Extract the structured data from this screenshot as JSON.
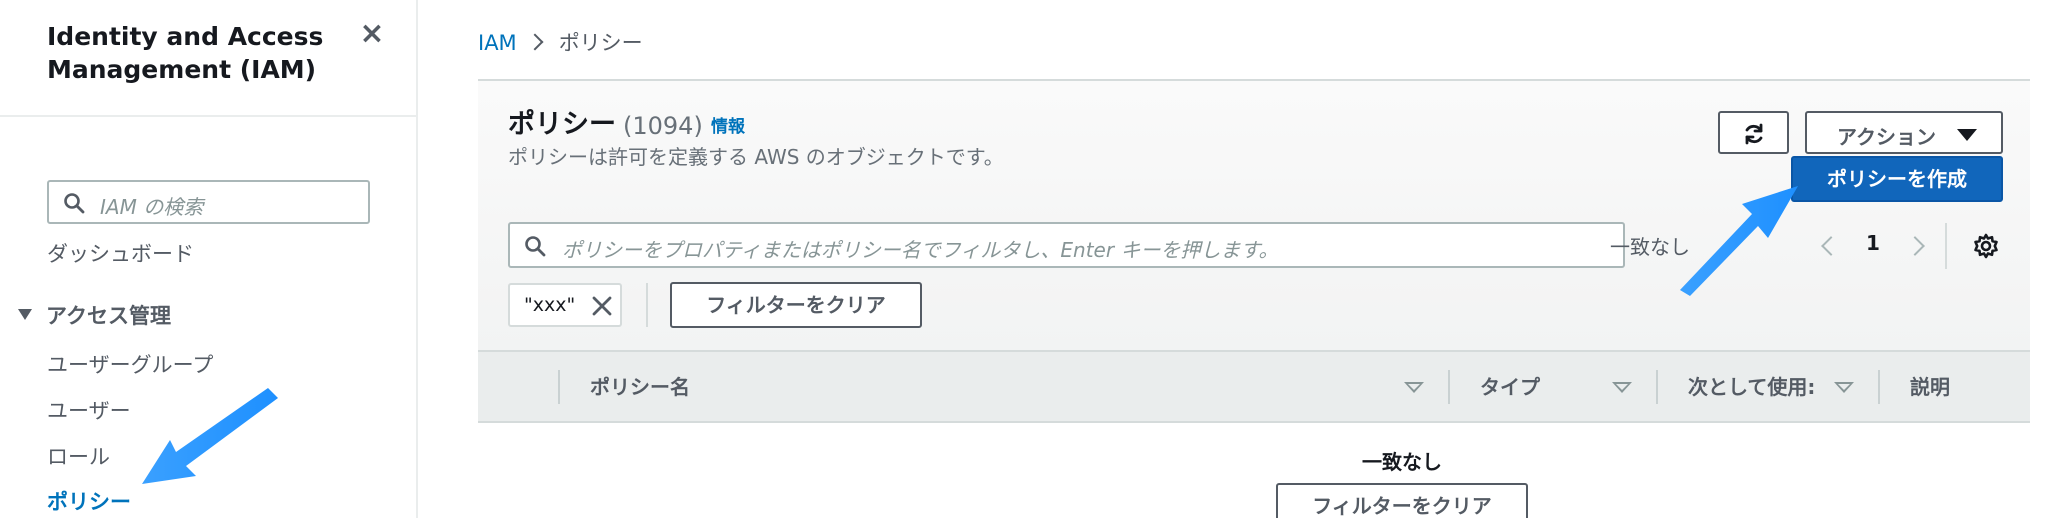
{
  "sidebar": {
    "title": "Identity and Access Management (IAM)",
    "close_icon": "close-icon",
    "search_placeholder": "IAM の検索",
    "dashboard_label": "ダッシュボード",
    "section_label": "アクセス管理",
    "items": [
      {
        "label": "ユーザーグループ"
      },
      {
        "label": "ユーザー"
      },
      {
        "label": "ロール"
      },
      {
        "label": "ポリシー",
        "active": true
      }
    ]
  },
  "breadcrumb": {
    "root": "IAM",
    "current": "ポリシー"
  },
  "panel": {
    "title": "ポリシー",
    "count": "(1094)",
    "info_label": "情報",
    "description": "ポリシーは許可を定義する AWS のオブジェクトです。",
    "actions_label": "アクション",
    "create_label": "ポリシーを作成",
    "filter_placeholder": "ポリシーをプロパティまたはポリシー名でフィルタし、Enter キーを押します。",
    "match_text": "一致なし",
    "page_number": "1",
    "token_label": "\"xxx\"",
    "clear_filter_label": "フィルターをクリア"
  },
  "table": {
    "columns": [
      {
        "label": "ポリシー名"
      },
      {
        "label": "タイプ"
      },
      {
        "label": "次として使用:"
      },
      {
        "label": "説明"
      }
    ],
    "empty_text": "一致なし",
    "empty_clear_label": "フィルターをクリア"
  },
  "colors": {
    "link": "#0073bb",
    "primary_button": "#1166bb",
    "annotation_arrow": "#1e90ff"
  }
}
